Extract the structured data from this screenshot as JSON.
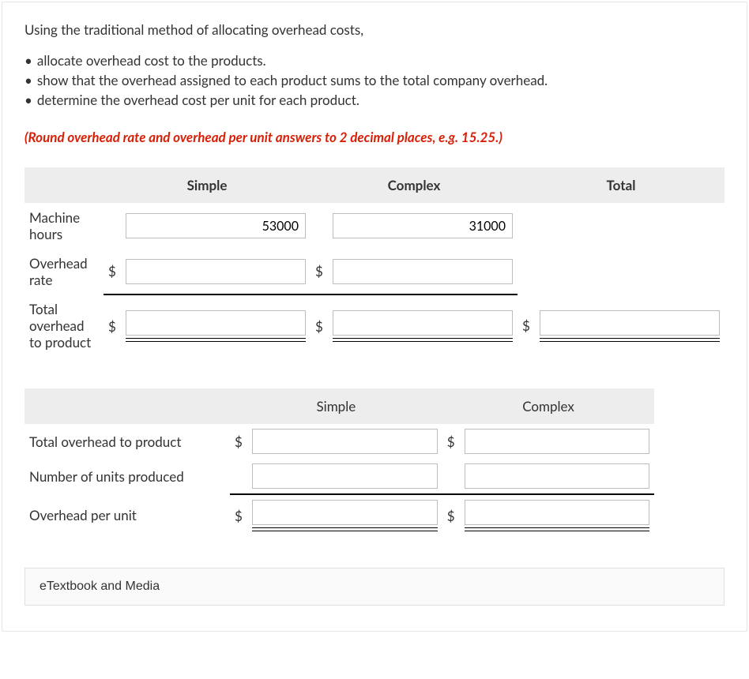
{
  "intro": "Using the traditional method of allocating overhead costs,",
  "bullets": [
    "allocate overhead cost to the products.",
    "show that the overhead assigned to each product sums to the total company overhead.",
    "determine the overhead cost per unit for each product."
  ],
  "instruction": "(Round overhead rate and overhead per unit answers to 2 decimal places, e.g. 15.25.)",
  "table1": {
    "headers": {
      "simple": "Simple",
      "complex": "Complex",
      "total": "Total"
    },
    "rows": {
      "r1": {
        "label": "Machine hours",
        "simple": "53000",
        "complex": "31000"
      },
      "r2": {
        "label": "Overhead rate",
        "simple": "",
        "complex": ""
      },
      "r3": {
        "label": "Total overhead to product",
        "simple": "",
        "complex": "",
        "total": ""
      }
    },
    "currency": "$"
  },
  "table2": {
    "headers": {
      "simple": "Simple",
      "complex": "Complex"
    },
    "rows": {
      "r1": {
        "label": "Total overhead to product",
        "simple": "",
        "complex": ""
      },
      "r2": {
        "label": "Number of units produced",
        "simple": "",
        "complex": ""
      },
      "r3": {
        "label": "Overhead per unit",
        "simple": "",
        "complex": ""
      }
    },
    "currency": "$"
  },
  "etextbook": "eTextbook and Media"
}
